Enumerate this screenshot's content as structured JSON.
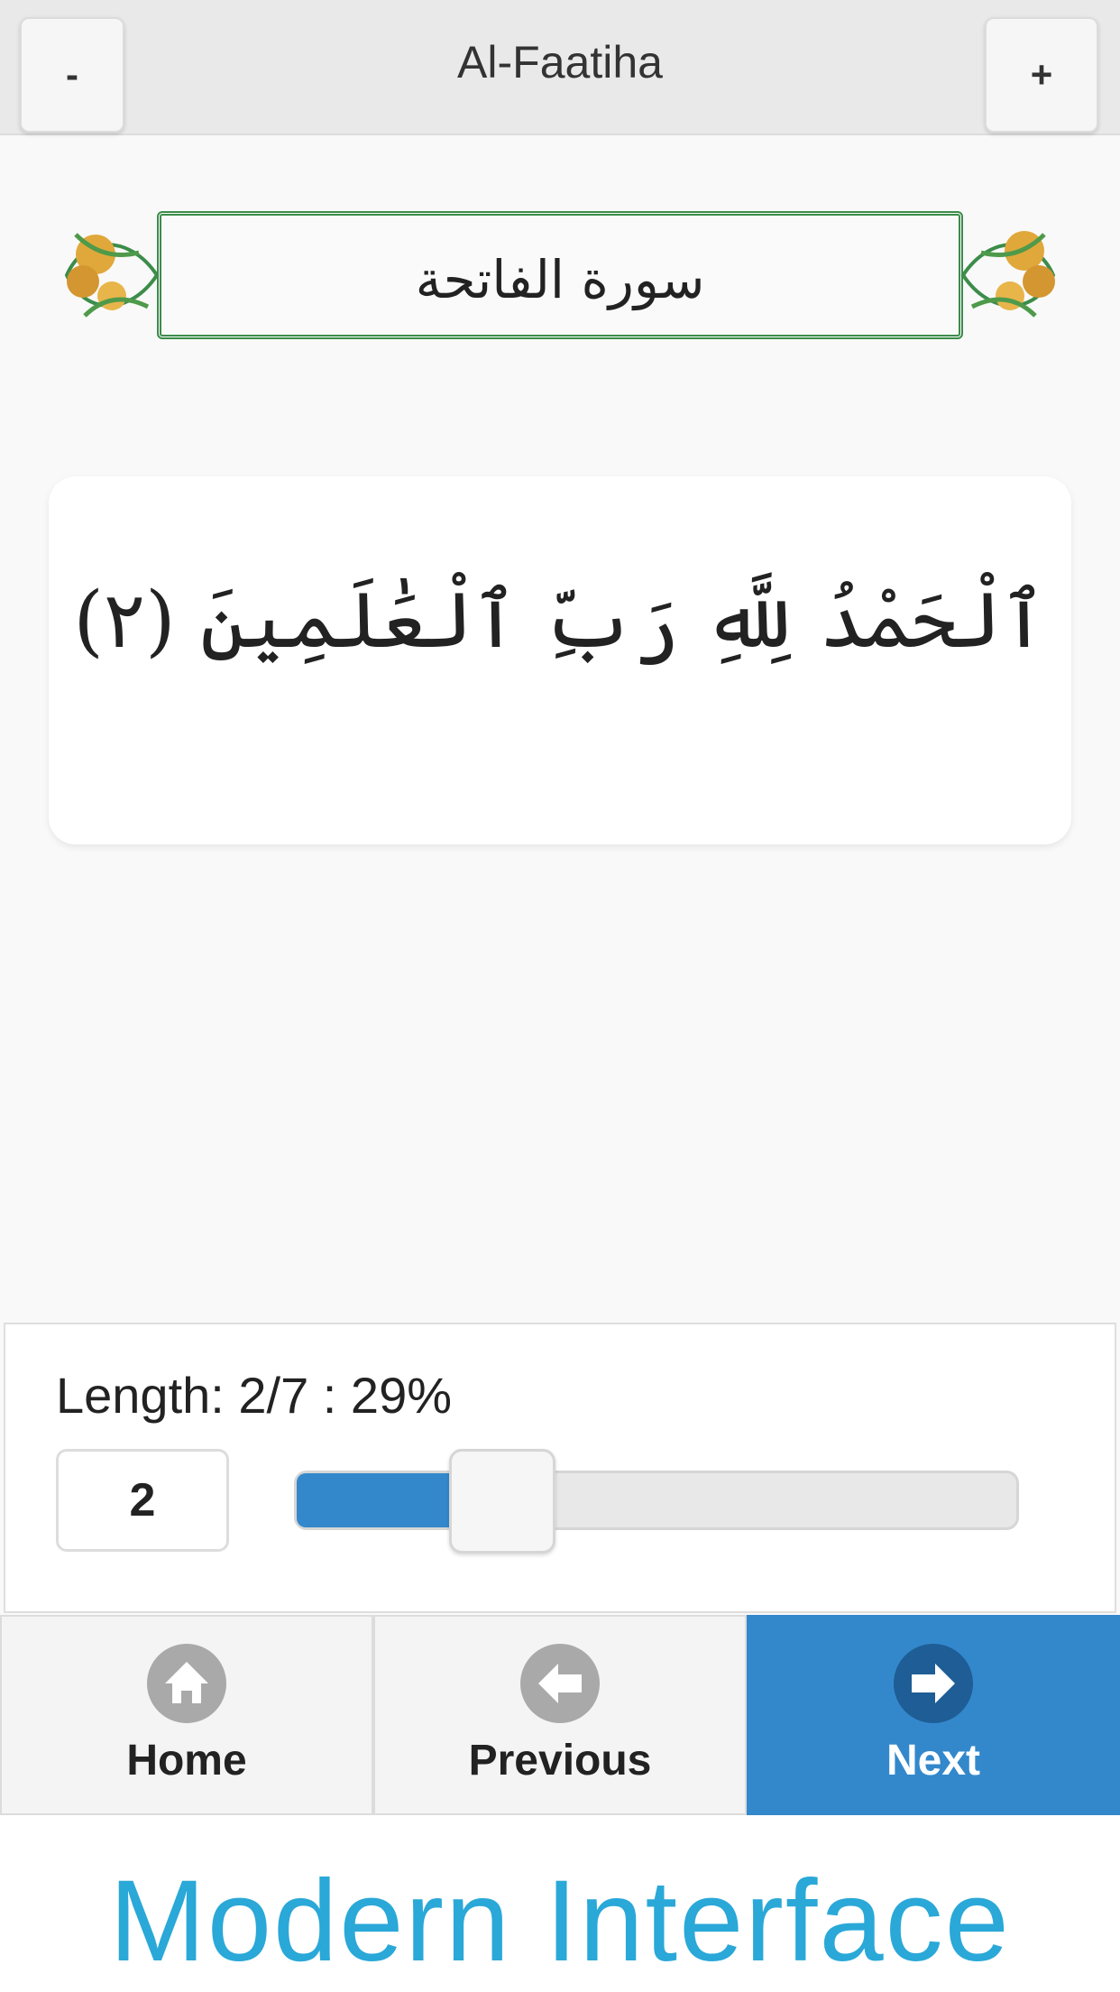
{
  "header": {
    "title": "Al-Faatiha",
    "decrease_label": "-",
    "increase_label": "+"
  },
  "surah_banner": {
    "title": "سورة الفاتحة"
  },
  "verse": {
    "text": "ٱلْحَمْدُ لِلَّهِ رَبِّ ٱلْعَٰلَمِينَ (٢)"
  },
  "progress": {
    "length_label": "Length: 2/7 : 29%",
    "current": "2",
    "total": 7,
    "percent": 29
  },
  "nav": {
    "home_label": "Home",
    "previous_label": "Previous",
    "next_label": "Next"
  },
  "promo": {
    "caption": "Modern Interface"
  },
  "colors": {
    "accent": "#3388cc",
    "promo_text": "#2aa8d8",
    "banner_border": "#3c8c4a"
  }
}
